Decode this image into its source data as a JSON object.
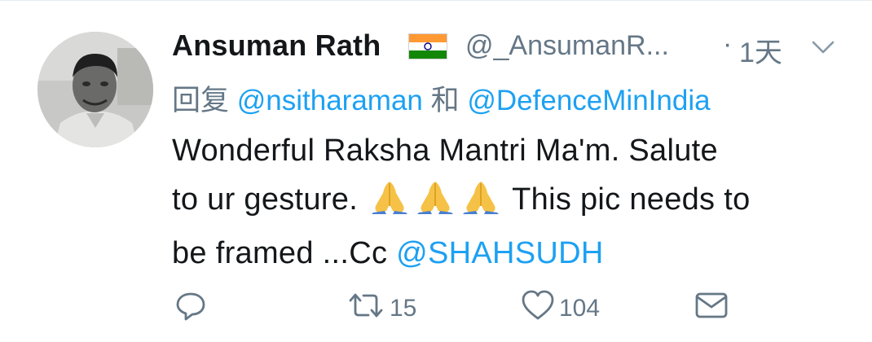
{
  "tweet": {
    "display_name": "Ansuman Rath",
    "handle": "@_AnsumanR...",
    "separator": "·",
    "time": "1天",
    "reply_prefix": "回复",
    "reply_mention_1": "@nsitharaman",
    "reply_and": "和",
    "reply_mention_2": "@DefenceMinIndia",
    "body_line_1": "Wonderful Raksha Mantri Ma'm. Salute",
    "body_line_2_start": "to ur gesture.",
    "body_line_2_end": "This pic needs to",
    "body_line_3_start": "be framed ...Cc",
    "body_mention": "@SHAHSUDH",
    "emoji": "folded-hands",
    "emoji_count": 3
  },
  "actions": {
    "reply_icon": "reply-icon",
    "retweet_icon": "retweet-icon",
    "retweet_count": "15",
    "like_icon": "heart-icon",
    "like_count": "104",
    "dm_icon": "envelope-icon"
  },
  "colors": {
    "link": "#1da1f2",
    "secondary": "#657786",
    "text": "#14171a"
  }
}
